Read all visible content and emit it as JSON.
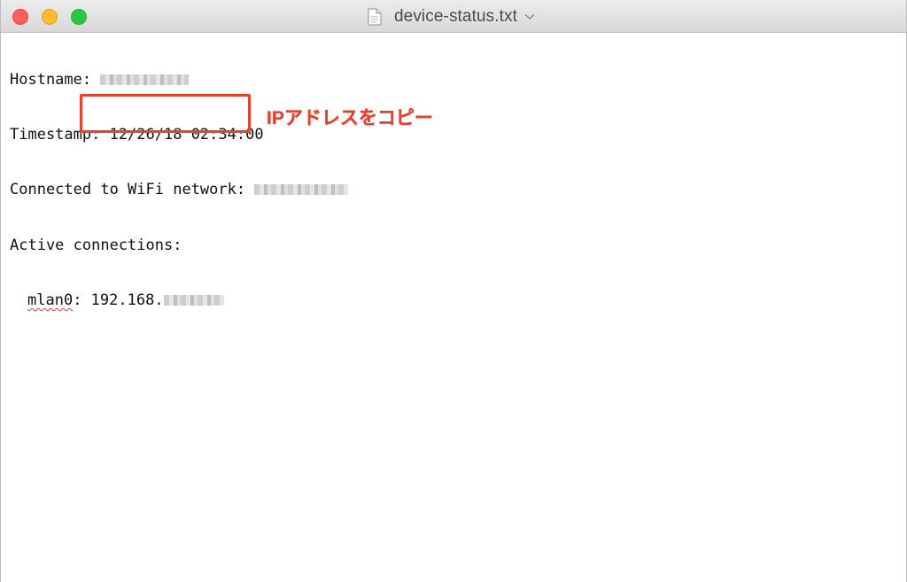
{
  "window": {
    "title": "device-status.txt",
    "icons": {
      "document": "document-icon",
      "chevron": "chevron-down-icon"
    }
  },
  "document": {
    "hostname_label": "Hostname: ",
    "timestamp_line": "Timestamp: 12/26/18 02:34:00",
    "wifi_label": "Connected to WiFi network: ",
    "active_connections": "Active connections:",
    "interface_name": "mlan0",
    "interface_sep": ": ",
    "ip_prefix": "192.168."
  },
  "annotation": {
    "text": "IPアドレスをコピー",
    "color": "#e8412c"
  },
  "colors": {
    "close": "#fc5f57",
    "minimize": "#fdbc2e",
    "zoom": "#28c840"
  }
}
